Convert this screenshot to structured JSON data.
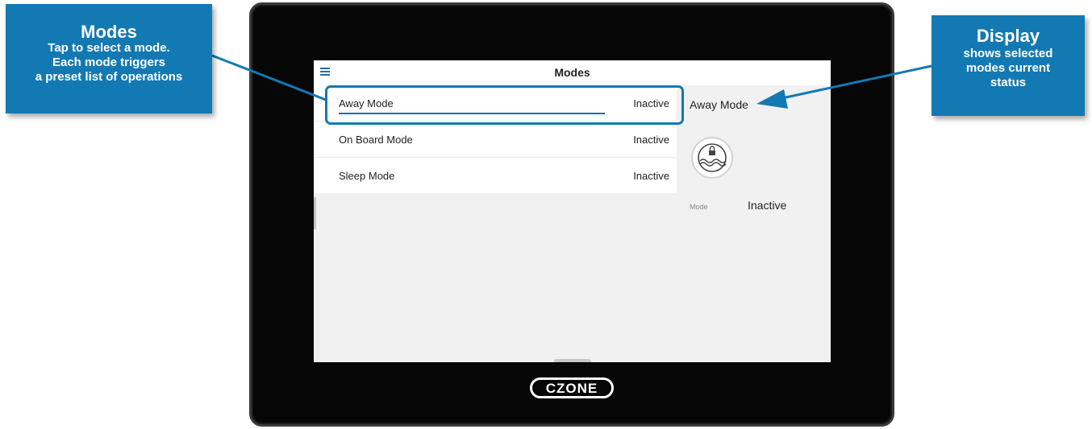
{
  "screen": {
    "title": "Modes",
    "modes": [
      {
        "label": "Away Mode",
        "state": "Inactive",
        "selected": true
      },
      {
        "label": "On Board Mode",
        "state": "Inactive",
        "selected": false
      },
      {
        "label": "Sleep Mode",
        "state": "Inactive",
        "selected": false
      }
    ],
    "detail": {
      "title": "Away Mode",
      "icon": "anchor-lock-icon",
      "field_label": "Mode",
      "field_value": "Inactive"
    }
  },
  "device": {
    "logo": "CZONE"
  },
  "callouts": {
    "modes": {
      "heading": "Modes",
      "lines": [
        "Tap to select a mode.",
        "Each mode triggers",
        "a preset list of operations"
      ]
    },
    "display": {
      "heading": "Display",
      "lines": [
        "shows selected",
        "modes current",
        "status"
      ]
    }
  },
  "colors": {
    "accent": "#1379b3",
    "bezel": "#060606",
    "screen_bg": "#f1f1f1"
  }
}
